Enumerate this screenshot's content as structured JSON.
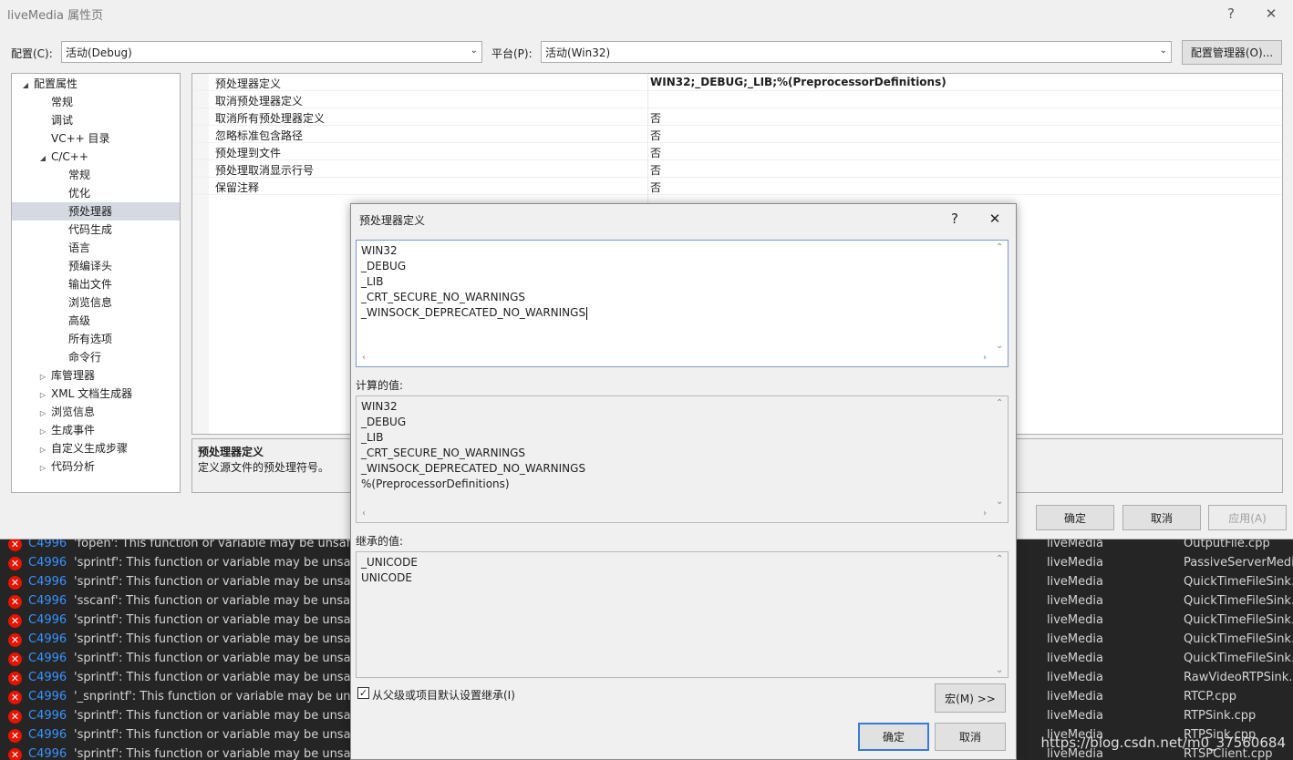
{
  "window": {
    "title": "liveMedia 属性页",
    "help_glyph": "?",
    "close_glyph": "✕"
  },
  "config": {
    "config_label": "配置(C):",
    "config_value": "活动(Debug)",
    "platform_label": "平台(P):",
    "platform_value": "活动(Win32)",
    "manager_button": "配置管理器(O)..."
  },
  "tree": {
    "items": [
      {
        "label": "配置属性",
        "arrow": "◢"
      },
      {
        "label": "常规",
        "arrow": ""
      },
      {
        "label": "调试",
        "arrow": ""
      },
      {
        "label": "VC++ 目录",
        "arrow": ""
      },
      {
        "label": "C/C++",
        "arrow": "◢"
      },
      {
        "label": "常规",
        "arrow": ""
      },
      {
        "label": "优化",
        "arrow": ""
      },
      {
        "label": "预处理器",
        "arrow": ""
      },
      {
        "label": "代码生成",
        "arrow": ""
      },
      {
        "label": "语言",
        "arrow": ""
      },
      {
        "label": "预编译头",
        "arrow": ""
      },
      {
        "label": "输出文件",
        "arrow": ""
      },
      {
        "label": "浏览信息",
        "arrow": ""
      },
      {
        "label": "高级",
        "arrow": ""
      },
      {
        "label": "所有选项",
        "arrow": ""
      },
      {
        "label": "命令行",
        "arrow": ""
      },
      {
        "label": "库管理器",
        "arrow": "▷"
      },
      {
        "label": "XML 文档生成器",
        "arrow": "▷"
      },
      {
        "label": "浏览信息",
        "arrow": "▷"
      },
      {
        "label": "生成事件",
        "arrow": "▷"
      },
      {
        "label": "自定义生成步骤",
        "arrow": "▷"
      },
      {
        "label": "代码分析",
        "arrow": "▷"
      }
    ]
  },
  "grid": {
    "rows": [
      {
        "name": "预处理器定义",
        "value": "WIN32;_DEBUG;_LIB;%(PreprocessorDefinitions)"
      },
      {
        "name": "取消预处理器定义",
        "value": ""
      },
      {
        "name": "取消所有预处理器定义",
        "value": "否"
      },
      {
        "name": "忽略标准包含路径",
        "value": "否"
      },
      {
        "name": "预处理到文件",
        "value": "否"
      },
      {
        "name": "预处理取消显示行号",
        "value": "否"
      },
      {
        "name": "保留注释",
        "value": "否"
      }
    ]
  },
  "description": {
    "title": "预处理器定义",
    "body": "定义源文件的预处理符号。"
  },
  "main_buttons": {
    "ok": "确定",
    "cancel": "取消",
    "apply": "应用(A)"
  },
  "dialog": {
    "title": "预处理器定义",
    "help_glyph": "?",
    "close_glyph": "✕",
    "edit_lines": [
      "WIN32",
      "_DEBUG",
      "_LIB",
      "_CRT_SECURE_NO_WARNINGS",
      "_WINSOCK_DEPRECATED_NO_WARNINGS"
    ],
    "computed_label": "计算的值:",
    "computed_lines": [
      "WIN32",
      "_DEBUG",
      "_LIB",
      "_CRT_SECURE_NO_WARNINGS",
      "_WINSOCK_DEPRECATED_NO_WARNINGS",
      "%(PreprocessorDefinitions)"
    ],
    "inherited_label": "继承的值:",
    "inherited_lines": [
      "_UNICODE",
      "UNICODE"
    ],
    "inherit_checkbox_label": "从父级或项目默认设置继承(I)",
    "inherit_checked": true,
    "check_glyph": "✓",
    "macro_button": "宏(M) >>",
    "ok": "确定",
    "cancel": "取消"
  },
  "errors": {
    "rows": [
      {
        "code": "C4996",
        "msg": "'fopen': This function or variable may be unsafe. Cor",
        "project": "liveMedia",
        "file": "OutputFile.cpp"
      },
      {
        "code": "C4996",
        "msg": "'sprintf': This function or variable may be unsafe. Co",
        "project": "liveMedia",
        "file": "PassiveServerMediaS"
      },
      {
        "code": "C4996",
        "msg": "'sprintf': This function or variable may be unsafe. Co",
        "project": "liveMedia",
        "file": "QuickTimeFileSink.cp"
      },
      {
        "code": "C4996",
        "msg": "'sscanf': This function or variable may be unsafe. Cor",
        "project": "liveMedia",
        "file": "QuickTimeFileSink.cp"
      },
      {
        "code": "C4996",
        "msg": "'sprintf': This function or variable may be unsafe. Co",
        "project": "liveMedia",
        "file": "QuickTimeFileSink.cp"
      },
      {
        "code": "C4996",
        "msg": "'sprintf': This function or variable may be unsafe. Co",
        "project": "liveMedia",
        "file": "QuickTimeFileSink.cp"
      },
      {
        "code": "C4996",
        "msg": "'sprintf': This function or variable may be unsafe. Co",
        "project": "liveMedia",
        "file": "QuickTimeFileSink.cp"
      },
      {
        "code": "C4996",
        "msg": "'sprintf': This function or variable may be unsafe. Co",
        "project": "liveMedia",
        "file": "RawVideoRTPSink.cp"
      },
      {
        "code": "C4996",
        "msg": "'_snprintf': This function or variable may be unsafe. C",
        "project": "liveMedia",
        "file": "RTCP.cpp"
      },
      {
        "code": "C4996",
        "msg": "'sprintf': This function or variable may be unsafe. Co",
        "project": "liveMedia",
        "file": "RTPSink.cpp"
      },
      {
        "code": "C4996",
        "msg": "'sprintf': This function or variable may be unsafe. Co",
        "project": "liveMedia",
        "file": "RTPSink.cpp"
      },
      {
        "code": "C4996",
        "msg": "'sprintf': This function or variable may be unsafe. Co",
        "project": "liveMedia",
        "file": "RTSPClient.cpp"
      }
    ],
    "icon_glyph": "✕"
  },
  "watermark": "https://blog.csdn.net/m0_37560684",
  "colors": {
    "selection": "#d4d9e2",
    "error_red": "#e51400",
    "error_code_blue": "#3794ff",
    "dark_bg": "#252526",
    "accent": "#3a7bd5"
  }
}
